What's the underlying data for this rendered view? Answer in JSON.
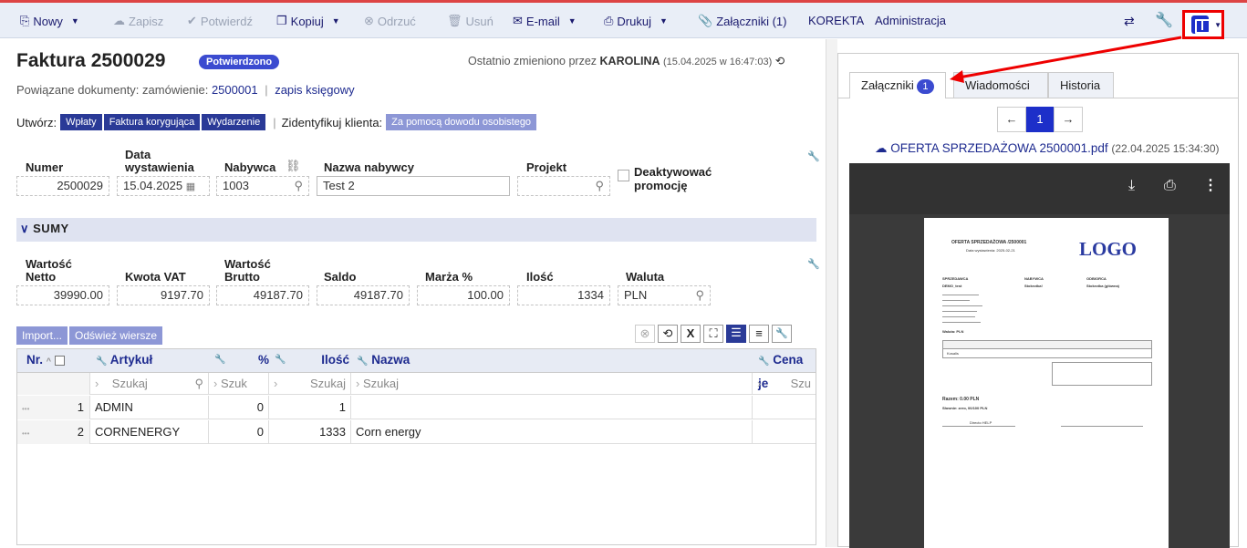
{
  "toolbar": {
    "new": "Nowy",
    "save": "Zapisz",
    "confirm": "Potwierdź",
    "copy": "Kopiuj",
    "reject": "Odrzuć",
    "delete": "Usuń",
    "email": "E-mail",
    "print": "Drukuj",
    "attachments": "Załączniki (1)",
    "korekta": "KOREKTA",
    "admin": "Administracja"
  },
  "header": {
    "title": "Faktura 2500029",
    "status": "Potwierdzono",
    "last_changed_prefix": "Ostatnio zmieniono przez",
    "last_changed_user": "KAROLINA",
    "last_changed_date": "(15.04.2025 w 16:47:03)",
    "related_label": "Powiązane dokumenty:",
    "related_order_label": "zamówienie:",
    "related_order_no": "2500001",
    "related_sep": "|",
    "related_entry": "zapis księgowy",
    "create_label": "Utwórz:",
    "create_buttons": [
      "Wpłaty",
      "Faktura korygująca",
      "Wydarzenie"
    ],
    "identify_label": "Zidentyfikuj klienta:",
    "identify_button": "Za pomocą dowodu osobistego"
  },
  "fields": {
    "number_label": "Numer",
    "number": "2500029",
    "date_label1": "Data",
    "date_label2": "wystawienia",
    "date": "15.04.2025",
    "buyer_label": "Nabywca",
    "buyer": "1003",
    "buyer_name_label": "Nazwa nabywcy",
    "buyer_name": "Test 2",
    "project_label": "Projekt",
    "project": "",
    "deactivate_label1": "Deaktywować",
    "deactivate_label2": "promocję"
  },
  "sums": {
    "section_title": "SUMY",
    "net_label1": "Wartość",
    "net_label2": "Netto",
    "net": "39990.00",
    "vat_label": "Kwota VAT",
    "vat": "9197.70",
    "gross_label1": "Wartość",
    "gross_label2": "Brutto",
    "gross": "49187.70",
    "balance_label": "Saldo",
    "balance": "49187.70",
    "margin_label": "Marża %",
    "margin": "100.00",
    "qty_label": "Ilość",
    "qty": "1334",
    "currency_label": "Waluta",
    "currency": "PLN"
  },
  "grid": {
    "import_btn": "Import...",
    "refresh_btn": "Odśwież wiersze",
    "col_nr": "Nr.",
    "col_article": "Artykuł",
    "col_pct": "%",
    "col_qty": "Ilość",
    "col_name": "Nazwa",
    "col_price": "Cena je",
    "search_article": "Szukaj",
    "search_pct": "Szuk",
    "search_qty": "Szukaj",
    "search_name": "Szukaj",
    "search_price": "Szu",
    "rows": [
      {
        "dots": "•••",
        "nr": "1",
        "article": "ADMIN",
        "pct": "0",
        "qty": "1",
        "name": ""
      },
      {
        "dots": "•••",
        "nr": "2",
        "article": "CORNENERGY",
        "pct": "0",
        "qty": "1333",
        "name": "Corn energy"
      }
    ]
  },
  "side": {
    "tab_attachments": "Załączniki",
    "tab_badge": "1",
    "tab_messages": "Wiadomości",
    "tab_history": "Historia",
    "page_prev": "←",
    "page_current": "1",
    "page_next": "→",
    "file_name": "OFERTA SPRZEDAŻOWA 2500001.pdf",
    "file_date": "(22.04.2025 15:34:30)"
  },
  "pdf": {
    "doc_title": "OFERTA SPRZEDAŻOWA /2500001",
    "issue_date": "Data wystawienia: 2025-02-21",
    "logo": "LOGO",
    "seller": "SPRZEDAWCA",
    "buyer": "NABYWCA",
    "recipient": "ODBIORCA",
    "seller_name": "DEMO_test",
    "buyer_name": "Stokrotka!",
    "recipient_name": "Stokrotka (główna)",
    "currency": "Waluta: PLN",
    "item": "Kosalis",
    "total": "Razem: 0.00 PLN",
    "in_words": "Słownie: zero, 00/100 PLN",
    "signature": "Directo HELP"
  },
  "colors": {
    "accent": "#1d2fc9",
    "highlight": "#e00000",
    "toolbar_bg": "#e9eef7",
    "section_bg": "#dfe3f1",
    "pdf_bg": "#3a3a3a"
  }
}
